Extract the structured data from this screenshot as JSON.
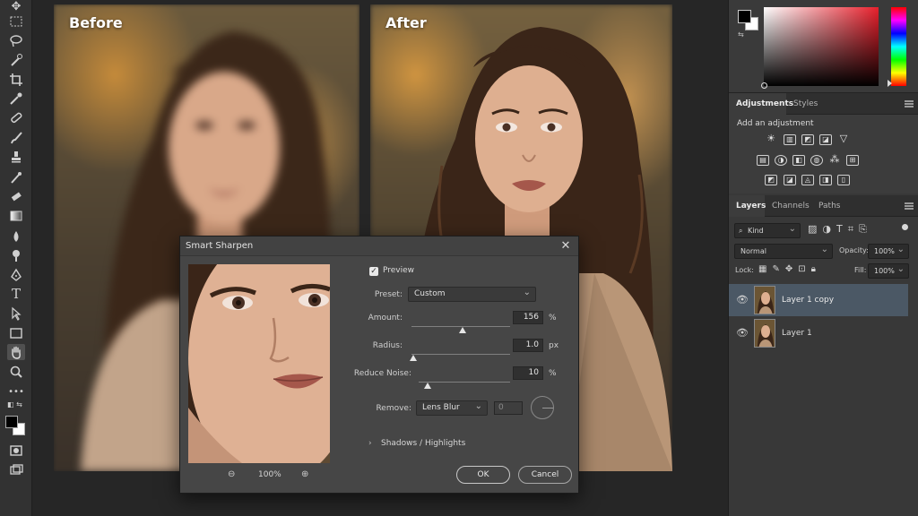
{
  "canvas": {
    "before_label": "Before",
    "after_label": "After"
  },
  "adjustments_panel": {
    "tabs": [
      "Adjustments",
      "Styles"
    ],
    "add_label": "Add an adjustment"
  },
  "layers_panel": {
    "tabs": [
      "Layers",
      "Channels",
      "Paths"
    ],
    "filter_kind": "Kind",
    "blend_mode": "Normal",
    "opacity_label": "Opacity:",
    "opacity_value": "100%",
    "lock_label": "Lock:",
    "fill_label": "Fill:",
    "fill_value": "100%",
    "layers": [
      {
        "name": "Layer 1 copy",
        "selected": true
      },
      {
        "name": "Layer 1",
        "selected": false
      }
    ]
  },
  "dialog": {
    "title": "Smart Sharpen",
    "preview_label": "Preview",
    "preview_checked": true,
    "preset_label": "Preset:",
    "preset_value": "Custom",
    "amount_label": "Amount:",
    "amount_value": "156",
    "amount_unit": "%",
    "amount_fraction": 0.52,
    "radius_label": "Radius:",
    "radius_value": "1.0",
    "radius_unit": "px",
    "radius_fraction": 0.02,
    "noise_label": "Reduce Noise:",
    "noise_value": "10",
    "noise_unit": "%",
    "noise_fraction": 0.1,
    "remove_label": "Remove:",
    "remove_value": "Lens Blur",
    "angle_value": "0",
    "shadows_label": "Shadows / Highlights",
    "zoom_value": "100%",
    "ok_label": "OK",
    "cancel_label": "Cancel"
  },
  "colors": {
    "foreground": "#000000",
    "background": "#ffffff",
    "selected_layer": "#4b5865"
  }
}
